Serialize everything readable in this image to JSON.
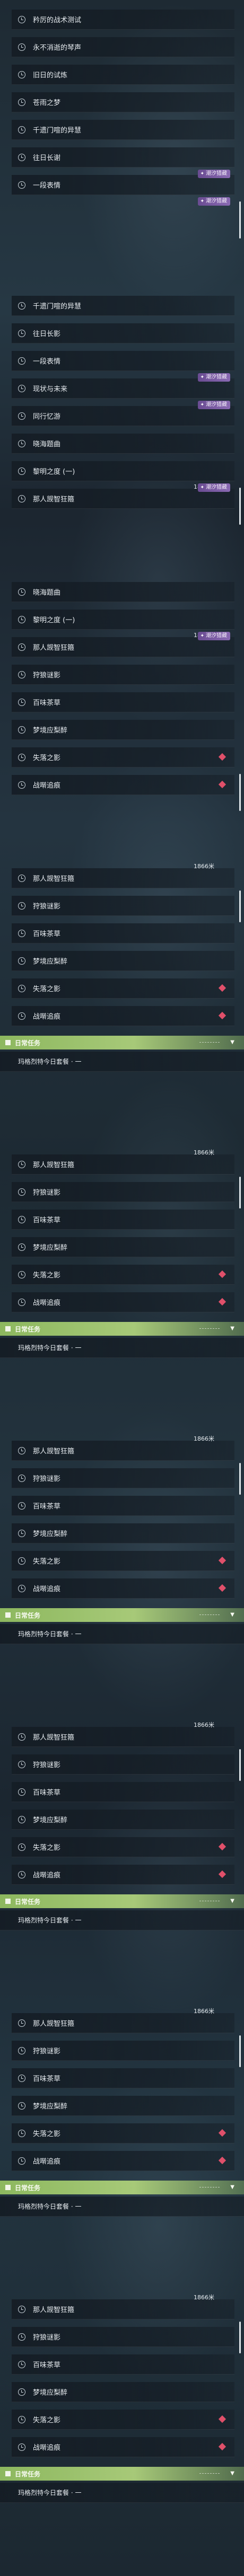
{
  "panels": [
    {
      "rows": [
        {
          "label": "矜厉的战术测试"
        },
        {
          "label": "永不消逝的琴声"
        },
        {
          "label": "旧日的试炼"
        },
        {
          "label": "苍雨之梦"
        },
        {
          "label": "千遗门喧的异慧"
        },
        {
          "label": "往日长谢"
        },
        {
          "label": "一段表情"
        }
      ],
      "badges": [
        {
          "text": "潮汐猎藏",
          "afterRow": 5
        },
        {
          "text": "潮汐猎藏",
          "afterRow": 6
        }
      ]
    },
    {
      "rows": [
        {
          "label": "千遗门喧的异慧"
        },
        {
          "label": "往日长影"
        },
        {
          "label": "一段表情"
        },
        {
          "label": "现状与未来"
        },
        {
          "label": "同行忆游"
        },
        {
          "label": "晓海题曲"
        },
        {
          "label": "黎明之度 (一)"
        },
        {
          "label": "那人觊智狂箍",
          "dist": "1866米"
        }
      ],
      "badges": [
        {
          "text": "潮汐猎藏",
          "afterRow": 2
        },
        {
          "text": "潮汐猎藏",
          "afterRow": 3
        },
        {
          "text": "潮汐猎藏",
          "afterRow": 6
        }
      ]
    },
    {
      "rows": [
        {
          "label": "晓海题曲"
        },
        {
          "label": "黎明之度 (一)"
        },
        {
          "label": "那人觊智狂箍",
          "dist": "1866米"
        },
        {
          "label": "狩狼谜影"
        },
        {
          "label": "百味茶草"
        },
        {
          "label": "梦境应梨醉"
        },
        {
          "label": "失落之影",
          "diamond": true
        },
        {
          "label": "战啭追痕",
          "diamond": true
        }
      ],
      "badges": [
        {
          "text": "潮汐猎藏",
          "afterRow": 1
        }
      ]
    }
  ],
  "repeat_block": {
    "rows": [
      {
        "label": "那人觊智狂箍",
        "dist": "1866米"
      },
      {
        "label": "狩狼谜影"
      },
      {
        "label": "百味茶草"
      },
      {
        "label": "梦境应梨醉"
      },
      {
        "label": "失落之影",
        "diamond": true
      },
      {
        "label": "战啭追痕",
        "diamond": true
      }
    ],
    "section_title": "日常任务",
    "section_item": "玛格烈特今日套餐 · 一"
  },
  "colors": {
    "accent": "#8db85f",
    "badge": "#6a4c92",
    "diamond": "#e0506a"
  }
}
